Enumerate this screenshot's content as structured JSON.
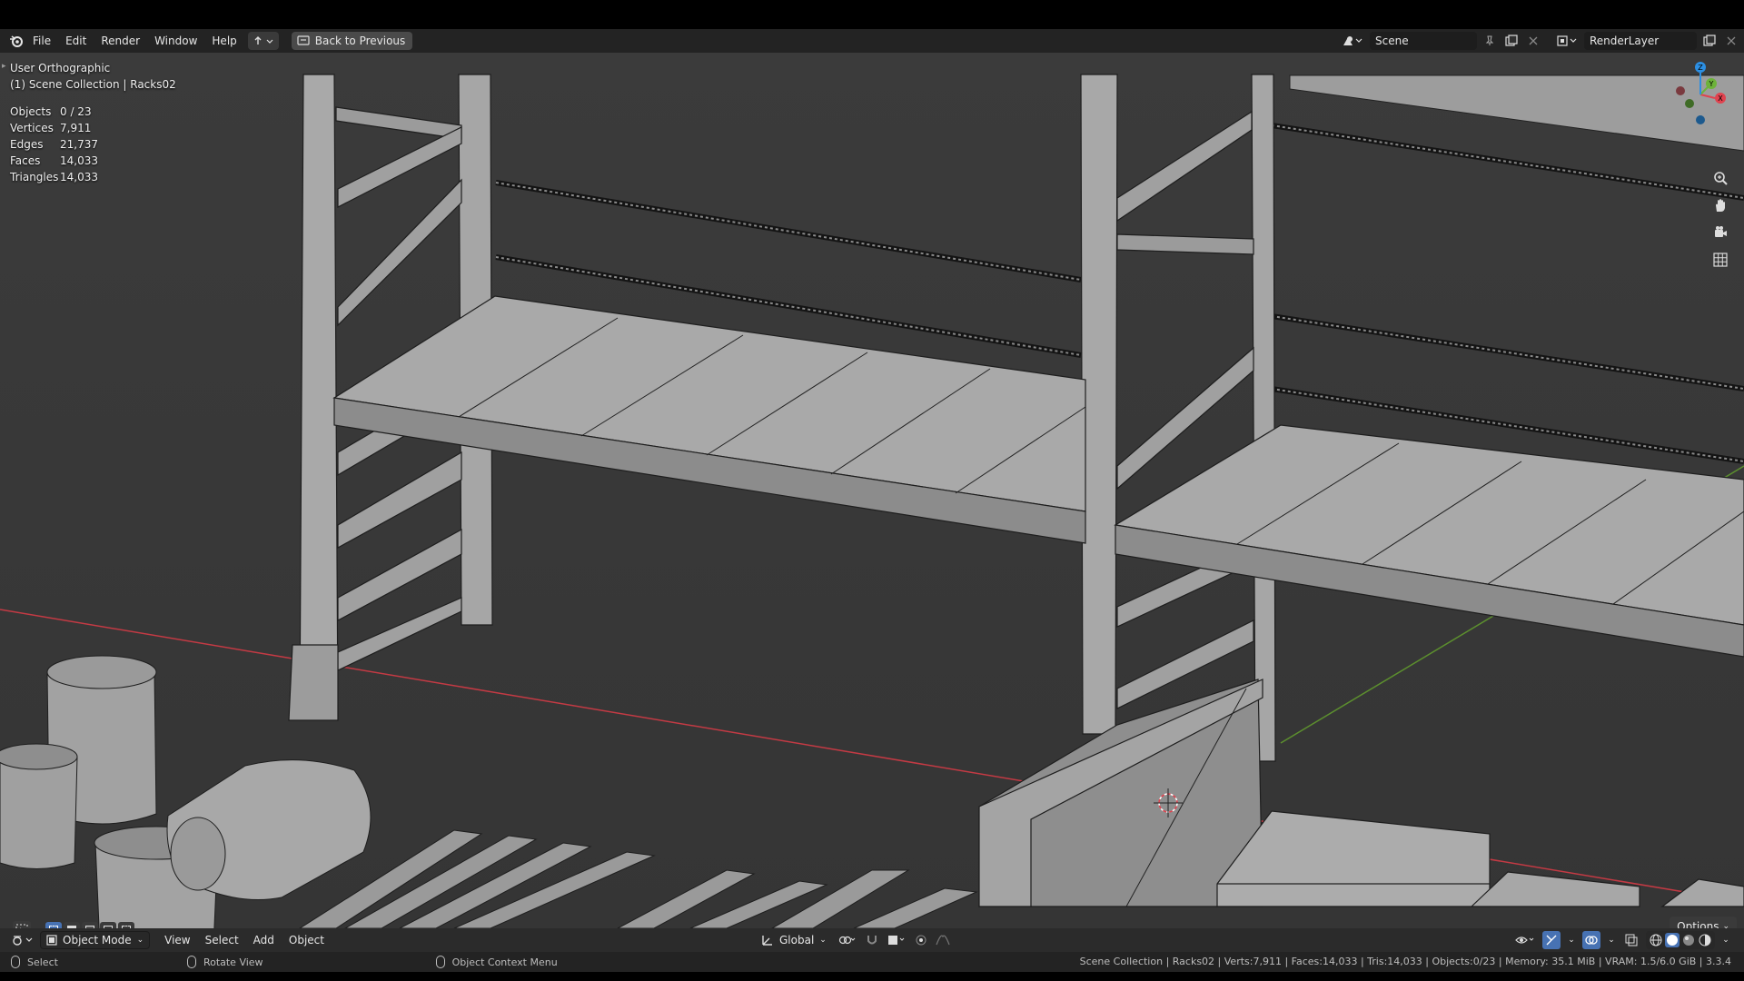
{
  "topbar": {
    "menus": [
      "File",
      "Edit",
      "Render",
      "Window",
      "Help"
    ],
    "back_button": "Back to Previous",
    "scene_name": "Scene",
    "render_layer": "RenderLayer",
    "logo_icon": "blender-logo-icon"
  },
  "viewport": {
    "view_name": "User Orthographic",
    "collection_info": "(1) Scene Collection | Racks02",
    "stats": [
      {
        "label": "Objects",
        "value": "0 / 23"
      },
      {
        "label": "Vertices",
        "value": "7,911"
      },
      {
        "label": "Edges",
        "value": "21,737"
      },
      {
        "label": "Faces",
        "value": "14,033"
      },
      {
        "label": "Triangles",
        "value": "14,033"
      }
    ],
    "gizmo_axes": {
      "x": "X",
      "y": "Y",
      "z": "Z"
    },
    "options_label": "Options",
    "colors": {
      "x_axis": "#e0434f",
      "y_axis": "#6db23a",
      "z_axis": "#2c8fe3",
      "background": "#3d3d3d",
      "geometry": "#a8a8a8"
    }
  },
  "viewhead": {
    "mode": "Object Mode",
    "menus": [
      "View",
      "Select",
      "Add",
      "Object"
    ],
    "transform_orientation": "Global"
  },
  "statusbar": {
    "select": "Select",
    "rotate": "Rotate View",
    "context": "Object Context Menu",
    "info": "Scene Collection | Racks02 | Verts:7,911 | Faces:14,033 | Tris:14,033 | Objects:0/23 | Memory: 35.1 MiB | VRAM: 1.5/6.0 GiB | 3.3.4"
  }
}
